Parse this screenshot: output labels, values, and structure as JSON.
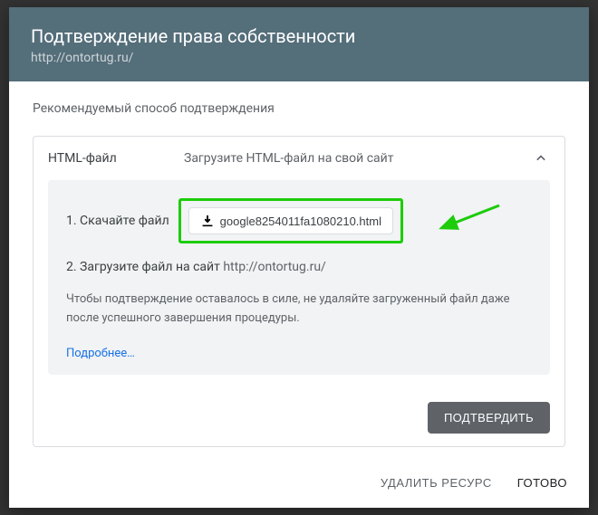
{
  "header": {
    "title": "Подтверждение права собственности",
    "subtitle": "http://ontortug.ru/"
  },
  "body": {
    "recommended_label": "Рекомендуемый способ подтверждения",
    "method": {
      "title": "HTML-файл",
      "description": "Загрузите HTML-файл на свой сайт"
    },
    "step1": {
      "text": "1. Скачайте файл",
      "filename": "google8254011fa1080210.html"
    },
    "step2": {
      "text": "2. Загрузите файл на сайт ",
      "url": "http://ontortug.ru/"
    },
    "note": "Чтобы подтверждение оставалось в силе, не удаляйте загруженный файл даже после успешного завершения процедуры.",
    "more_link": "Подробнее…",
    "verify_button": "ПОДТВЕРДИТЬ"
  },
  "footer": {
    "delete_button": "УДАЛИТЬ РЕСУРС",
    "done_button": "ГОТОВО"
  }
}
